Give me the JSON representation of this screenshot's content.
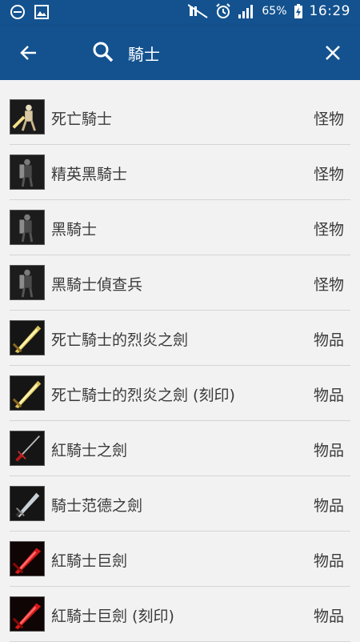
{
  "status_bar": {
    "battery": "65%",
    "time": "16:29"
  },
  "search": {
    "query": "騎士"
  },
  "results": [
    {
      "name": "死亡騎士",
      "type": "怪物",
      "icon": "death-knight-icon",
      "kind": "knight-gold"
    },
    {
      "name": "精英黑騎士",
      "type": "怪物",
      "icon": "black-knight-icon",
      "kind": "knight-dark"
    },
    {
      "name": "黑騎士",
      "type": "怪物",
      "icon": "black-knight-icon",
      "kind": "knight-dark"
    },
    {
      "name": "黑騎士偵查兵",
      "type": "怪物",
      "icon": "black-knight-icon",
      "kind": "knight-dark"
    },
    {
      "name": "死亡騎士的烈炎之劍",
      "type": "物品",
      "icon": "flame-sword-icon",
      "kind": "sword-gold"
    },
    {
      "name": "死亡騎士的烈炎之劍 (刻印)",
      "type": "物品",
      "icon": "flame-sword-icon",
      "kind": "sword-gold"
    },
    {
      "name": "紅騎士之劍",
      "type": "物品",
      "icon": "red-sword-icon",
      "kind": "sword-red-thin"
    },
    {
      "name": "騎士范德之劍",
      "type": "物品",
      "icon": "silver-sword-icon",
      "kind": "sword-silver"
    },
    {
      "name": "紅騎士巨劍",
      "type": "物品",
      "icon": "red-greatsword-icon",
      "kind": "sword-red"
    },
    {
      "name": "紅騎士巨劍 (刻印)",
      "type": "物品",
      "icon": "red-greatsword-icon",
      "kind": "sword-red"
    }
  ]
}
